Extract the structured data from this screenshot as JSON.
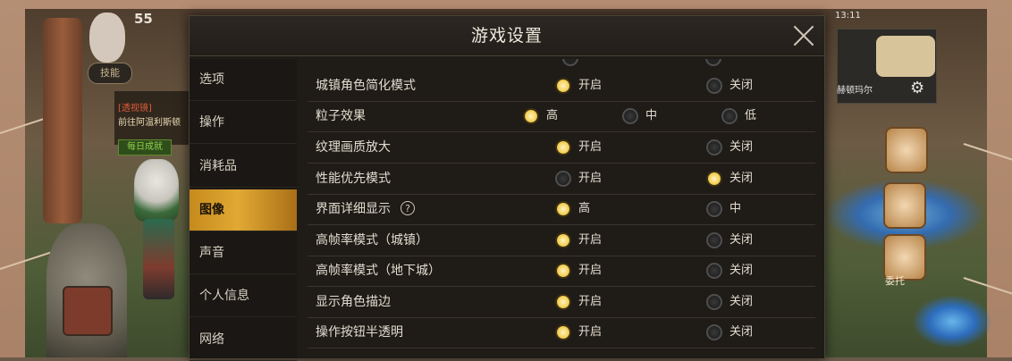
{
  "hud": {
    "level": "55",
    "chip": "技能",
    "lines": [
      "[透视镜]",
      "前往阿温利斯顿",
      "每日成就"
    ],
    "status_time": "13:11",
    "minimap_label": "赫顿玛尔",
    "npc_label": "委托"
  },
  "dialog": {
    "title": "游戏设置",
    "close_label": "×"
  },
  "sidebar": {
    "items": [
      {
        "label": "选项",
        "active": false
      },
      {
        "label": "操作",
        "active": false
      },
      {
        "label": "消耗品",
        "active": false
      },
      {
        "label": "图像",
        "active": true
      },
      {
        "label": "声音",
        "active": false
      },
      {
        "label": "个人信息",
        "active": false
      },
      {
        "label": "网络",
        "active": false
      }
    ]
  },
  "settings": {
    "rows": [
      {
        "label": "城镇角色简化模式",
        "options": [
          {
            "text": "开启",
            "selected": true
          },
          {
            "text": "关闭",
            "selected": false
          }
        ]
      },
      {
        "label": "粒子效果",
        "options": [
          {
            "text": "高",
            "selected": true
          },
          {
            "text": "中",
            "selected": false
          },
          {
            "text": "低",
            "selected": false
          }
        ]
      },
      {
        "label": "纹理画质放大",
        "options": [
          {
            "text": "开启",
            "selected": true
          },
          {
            "text": "关闭",
            "selected": false
          }
        ]
      },
      {
        "label": "性能优先模式",
        "options": [
          {
            "text": "开启",
            "selected": false
          },
          {
            "text": "关闭",
            "selected": true
          }
        ]
      },
      {
        "label": "界面详细显示",
        "help": "?",
        "options": [
          {
            "text": "高",
            "selected": true
          },
          {
            "text": "中",
            "selected": false
          }
        ]
      },
      {
        "label": "高帧率模式（城镇）",
        "options": [
          {
            "text": "开启",
            "selected": true
          },
          {
            "text": "关闭",
            "selected": false
          }
        ]
      },
      {
        "label": "高帧率模式（地下城）",
        "options": [
          {
            "text": "开启",
            "selected": true
          },
          {
            "text": "关闭",
            "selected": false
          }
        ]
      },
      {
        "label": "显示角色描边",
        "options": [
          {
            "text": "开启",
            "selected": true
          },
          {
            "text": "关闭",
            "selected": false
          }
        ]
      },
      {
        "label": "操作按钮半透明",
        "options": [
          {
            "text": "开启",
            "selected": true
          },
          {
            "text": "关闭",
            "selected": false
          }
        ]
      }
    ]
  }
}
